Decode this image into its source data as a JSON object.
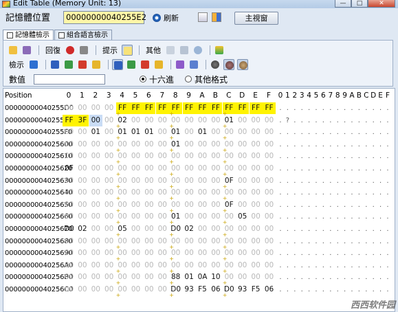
{
  "window": {
    "title": "Edit Table (Memory Unit: 13)",
    "minimize": "—",
    "maximize": "□",
    "close": "✕"
  },
  "address": {
    "label": "記憶體位置",
    "value": "00000000040255E2",
    "refresh_label": "刷新",
    "main_view_label": "主視窗"
  },
  "tabs": [
    {
      "label": "記憶體檢示"
    },
    {
      "label": "組合語言檢示"
    }
  ],
  "toolbar": {
    "row1_labels": {
      "restore": "回復",
      "hint": "提示",
      "other": "其他"
    },
    "row2_labels": {
      "search": "檢示"
    },
    "row3_labels": {
      "value": "數值"
    },
    "radio_hex": "十六進",
    "radio_other": "其他格式"
  },
  "grid": {
    "position_label": "Position",
    "columns": [
      "0",
      "1",
      "2",
      "3",
      "4",
      "5",
      "6",
      "7",
      "8",
      "9",
      "A",
      "B",
      "C",
      "D",
      "E",
      "F"
    ],
    "ascii_header": "0123456789ABCDEF",
    "rows": [
      {
        "addr": "00000000040255D0",
        "cells": [
          "00",
          "00",
          "00",
          "00",
          "FF",
          "FF",
          "FF",
          "FF",
          "FF",
          "FF",
          "FF",
          "FF",
          "FF",
          "FF",
          "FF",
          "FF"
        ],
        "ascii": "................"
      },
      {
        "addr": "00000000040255E0",
        "cells": [
          "FF",
          "3F",
          "00",
          "00",
          "02",
          "00",
          "00",
          "00",
          "00",
          "00",
          "00",
          "00",
          "01",
          "00",
          "00",
          "00"
        ],
        "ascii": ".?.............."
      },
      {
        "addr": "00000000040255F0",
        "cells": [
          "00",
          "00",
          "01",
          "00",
          "01",
          "01",
          "01",
          "00",
          "01",
          "00",
          "01",
          "00",
          "00",
          "00",
          "00",
          "00"
        ],
        "ascii": "................"
      },
      {
        "addr": "0000000004025600",
        "cells": [
          "00",
          "00",
          "00",
          "00",
          "00",
          "00",
          "00",
          "00",
          "01",
          "00",
          "00",
          "00",
          "00",
          "00",
          "00",
          "00"
        ],
        "ascii": "................"
      },
      {
        "addr": "0000000004025610",
        "cells": [
          "00",
          "00",
          "00",
          "00",
          "00",
          "00",
          "00",
          "00",
          "00",
          "00",
          "00",
          "00",
          "00",
          "00",
          "00",
          "00"
        ],
        "ascii": "................"
      },
      {
        "addr": "0000000004025620",
        "cells": [
          "0F",
          "00",
          "00",
          "00",
          "00",
          "00",
          "00",
          "00",
          "00",
          "00",
          "00",
          "00",
          "00",
          "00",
          "00",
          "00"
        ],
        "ascii": "................"
      },
      {
        "addr": "0000000004025630",
        "cells": [
          "00",
          "00",
          "00",
          "00",
          "00",
          "00",
          "00",
          "00",
          "00",
          "00",
          "00",
          "00",
          "0F",
          "00",
          "00",
          "00"
        ],
        "ascii": "................"
      },
      {
        "addr": "0000000004025640",
        "cells": [
          "00",
          "00",
          "00",
          "00",
          "00",
          "00",
          "00",
          "00",
          "00",
          "00",
          "00",
          "00",
          "00",
          "00",
          "00",
          "00"
        ],
        "ascii": "................"
      },
      {
        "addr": "0000000004025650",
        "cells": [
          "00",
          "00",
          "00",
          "00",
          "00",
          "00",
          "00",
          "00",
          "00",
          "00",
          "00",
          "00",
          "0F",
          "00",
          "00",
          "00"
        ],
        "ascii": "................"
      },
      {
        "addr": "0000000004025660",
        "cells": [
          "00",
          "00",
          "00",
          "00",
          "00",
          "00",
          "00",
          "00",
          "01",
          "00",
          "00",
          "00",
          "00",
          "05",
          "00",
          "00"
        ],
        "ascii": "................"
      },
      {
        "addr": "0000000004025670",
        "cells": [
          "D0",
          "02",
          "00",
          "00",
          "05",
          "00",
          "00",
          "00",
          "D0",
          "02",
          "00",
          "00",
          "00",
          "00",
          "00",
          "00"
        ],
        "ascii": "................"
      },
      {
        "addr": "0000000004025680",
        "cells": [
          "00",
          "00",
          "00",
          "00",
          "00",
          "00",
          "00",
          "00",
          "00",
          "00",
          "00",
          "00",
          "00",
          "00",
          "00",
          "00"
        ],
        "ascii": "................"
      },
      {
        "addr": "0000000004025690",
        "cells": [
          "00",
          "00",
          "00",
          "00",
          "00",
          "00",
          "00",
          "00",
          "00",
          "00",
          "00",
          "00",
          "00",
          "00",
          "00",
          "00"
        ],
        "ascii": "................"
      },
      {
        "addr": "00000000040256A0",
        "cells": [
          "00",
          "00",
          "00",
          "00",
          "00",
          "00",
          "00",
          "00",
          "00",
          "00",
          "00",
          "00",
          "00",
          "00",
          "00",
          "00"
        ],
        "ascii": "................"
      },
      {
        "addr": "00000000040256B0",
        "cells": [
          "00",
          "00",
          "00",
          "00",
          "00",
          "00",
          "00",
          "00",
          "88",
          "01",
          "0A",
          "10",
          "00",
          "00",
          "00",
          "00"
        ],
        "ascii": "................"
      },
      {
        "addr": "00000000040256C0",
        "cells": [
          "00",
          "00",
          "00",
          "00",
          "00",
          "00",
          "00",
          "00",
          "D0",
          "93",
          "F5",
          "06",
          "D0",
          "93",
          "F5",
          "06"
        ],
        "ascii": "................"
      }
    ],
    "highlight": {
      "yellow_row": 0,
      "yellow_from": 4,
      "yellow_row2": 1,
      "yellow_cols2": [
        0,
        1
      ],
      "blue_row": 1,
      "blue_col": 2
    }
  },
  "watermark": "西西软件园",
  "colors": {
    "highlight_yellow": "#fff300",
    "selection_blue": "#c9dcf5",
    "frame": "#dfe8f3"
  }
}
